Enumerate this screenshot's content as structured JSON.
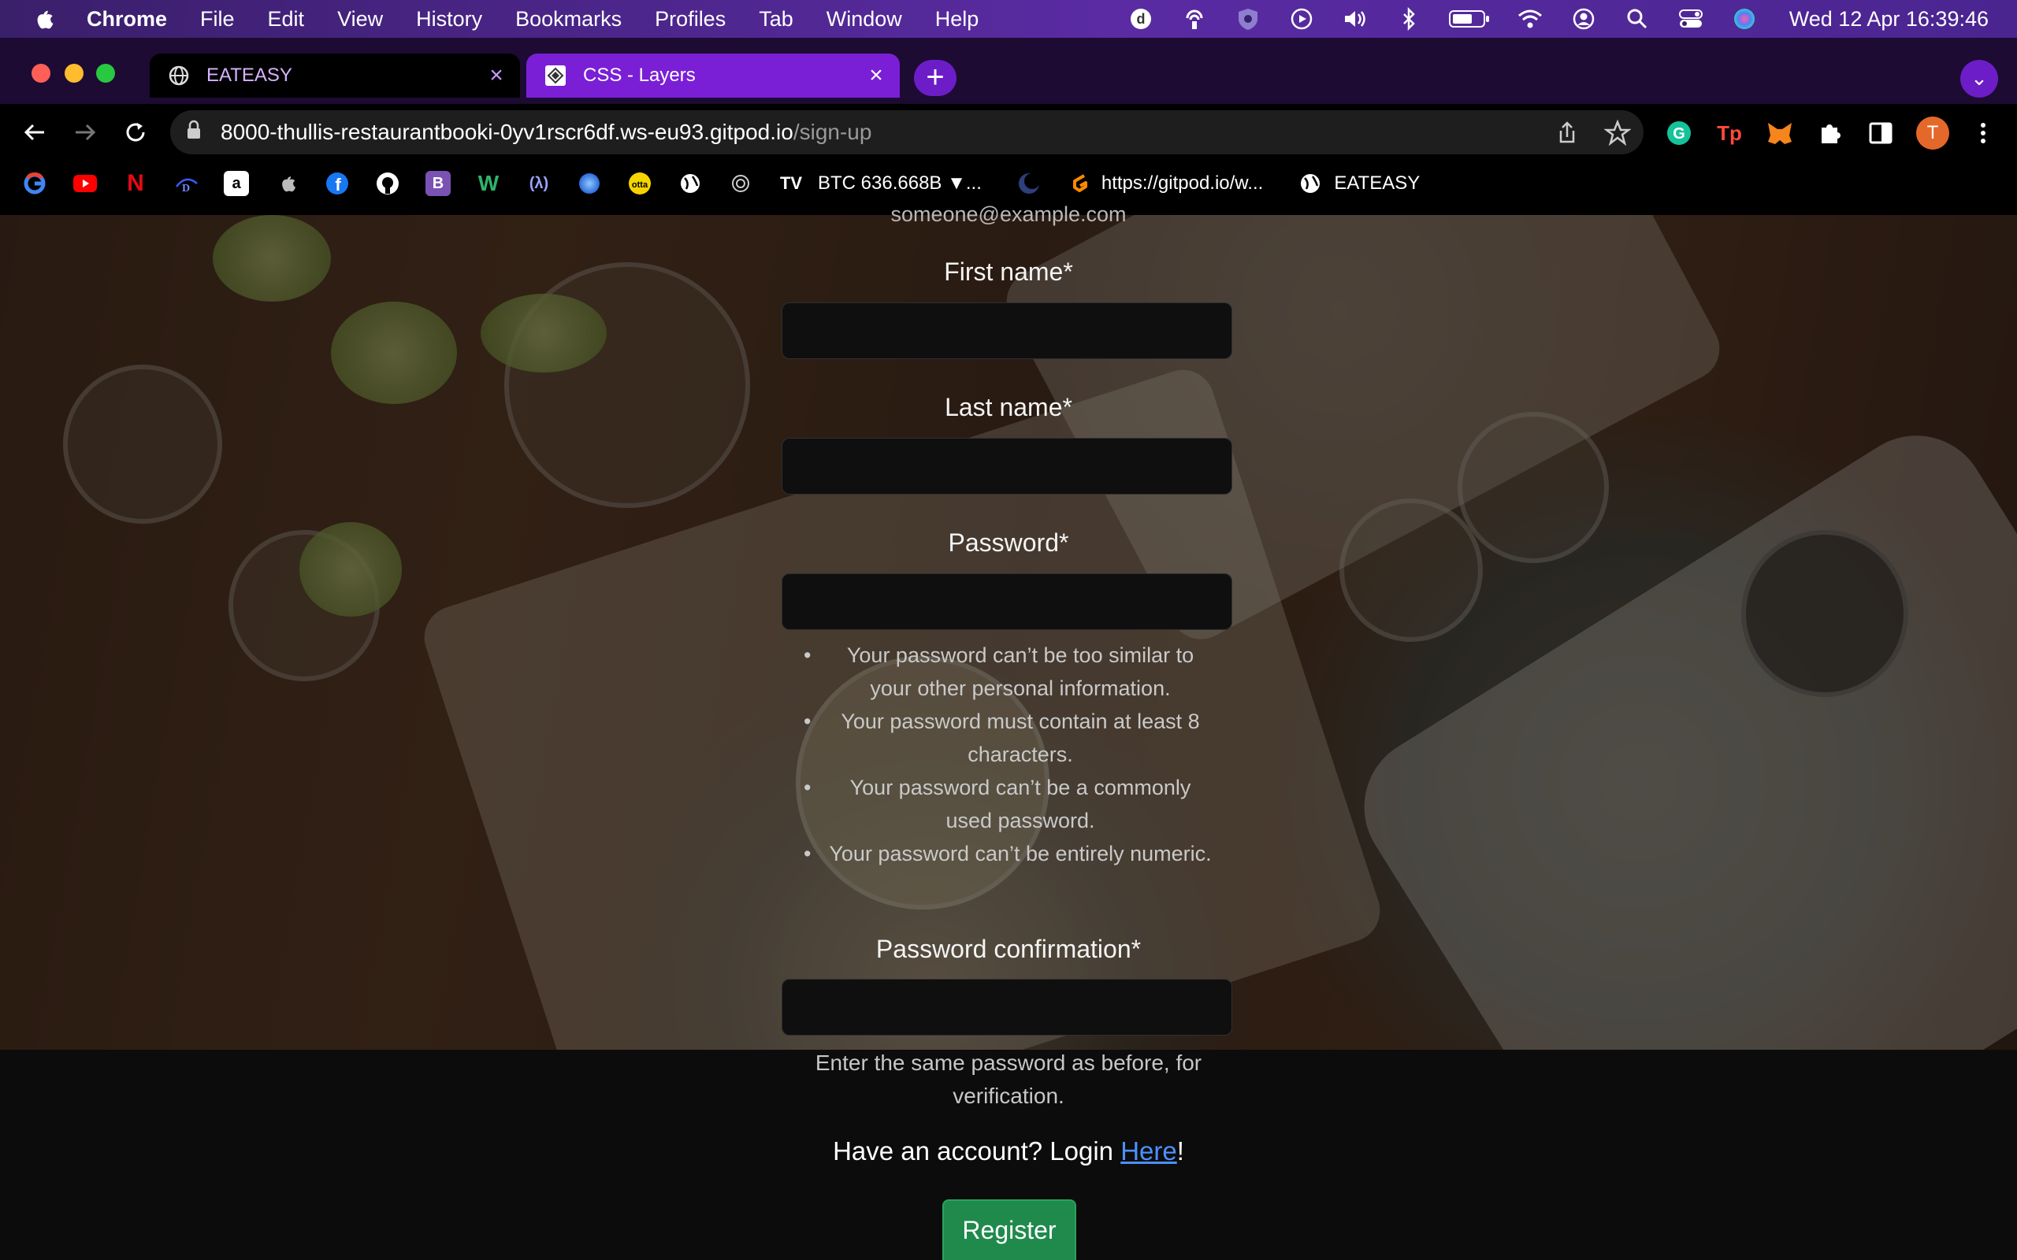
{
  "menubar": {
    "app": "Chrome",
    "items": [
      "File",
      "Edit",
      "View",
      "History",
      "Bookmarks",
      "Profiles",
      "Tab",
      "Window",
      "Help"
    ],
    "clock": "Wed 12 Apr  16:39:46"
  },
  "browser": {
    "tabs": [
      {
        "title": "EATEASY",
        "active": true
      },
      {
        "title": "CSS - Layers",
        "active": false
      }
    ],
    "url_host": "8000-thullis-restaurantbooki-0yv1rscr6df.ws-eu93.gitpod.io",
    "url_path": "/sign-up",
    "avatar_initial": "T",
    "bookmarks": {
      "btc": "BTC 636.668B ▼...",
      "gitpod": "https://gitpod.io/w...",
      "eateasy": "EATEASY"
    }
  },
  "signup": {
    "email_hint": "someone@example.com",
    "first_name_label": "First name*",
    "last_name_label": "Last name*",
    "password_label": "Password*",
    "password_rules": [
      "Your password can’t be too similar to your other personal information.",
      "Your password must contain at least 8 characters.",
      "Your password can’t be a commonly used password.",
      "Your password can’t be entirely numeric."
    ],
    "password_confirm_label": "Password confirmation*",
    "password_confirm_hint": "Enter the same password as before, for verification.",
    "login_prefix": "Have an account? Login ",
    "login_link": "Here",
    "login_suffix": "!",
    "register_button": "Register"
  }
}
